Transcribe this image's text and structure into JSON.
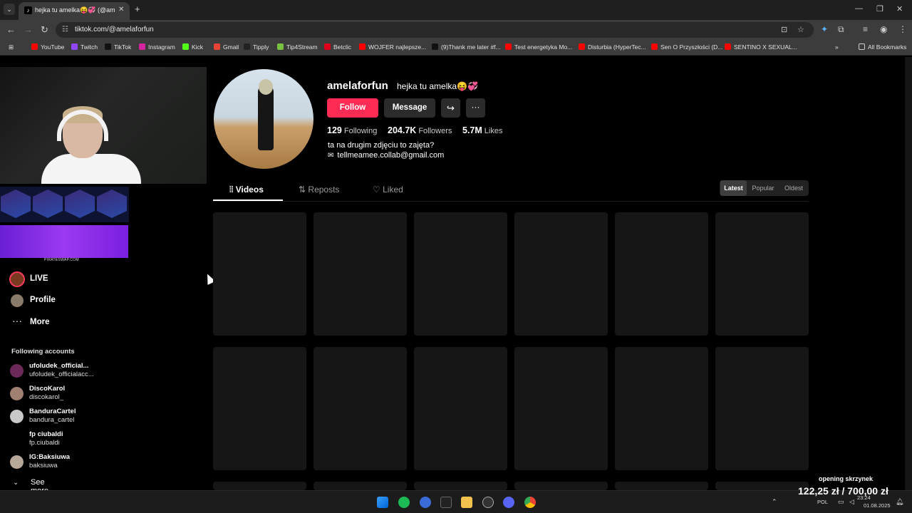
{
  "browser": {
    "tab_title": "hejka tu amelka😝💞 (@amelaforfun)",
    "url": "tiktok.com/@amelaforfun",
    "bookmarks": [
      {
        "label": "YouTube",
        "color": "#ff0000"
      },
      {
        "label": "Twitch",
        "color": "#9146ff"
      },
      {
        "label": "TikTok",
        "color": "#111111"
      },
      {
        "label": "Instagram",
        "color": "#d6249f"
      },
      {
        "label": "Kick",
        "color": "#53fc18"
      },
      {
        "label": "Gmail",
        "color": "#ea4335"
      },
      {
        "label": "Tipply",
        "color": "#222222"
      },
      {
        "label": "Tip4Stream",
        "color": "#7ac142"
      },
      {
        "label": "Betclic",
        "color": "#e1001a"
      },
      {
        "label": "WOJFER najlepsze...",
        "color": "#ff0000"
      },
      {
        "label": "(9)Thank me later #f...",
        "color": "#111111"
      },
      {
        "label": "Test energetyka Mo...",
        "color": "#ff0000"
      },
      {
        "label": "Disturbia (HyperTec...",
        "color": "#ff0000"
      },
      {
        "label": "Sen O Przyszłości (D...",
        "color": "#ff0000"
      },
      {
        "label": "SENTINO X SEXUAL...",
        "color": "#ff0000"
      }
    ],
    "all_bookmarks_label": "All Bookmarks"
  },
  "promo": {
    "site_text": "PIRATESWAP.COM"
  },
  "sidebar": {
    "items": [
      {
        "label": "LIVE",
        "icon": "live-avatar-icon"
      },
      {
        "label": "Profile",
        "icon": "profile-avatar-icon"
      },
      {
        "label": "More",
        "icon": "more-dots-icon"
      }
    ],
    "following_title": "Following accounts",
    "accounts": [
      {
        "name": "ufoludek_official...",
        "handle": "ufoludek_officialacc..."
      },
      {
        "name": "DiscoKarol",
        "handle": "discokarol_"
      },
      {
        "name": "BanduraCartel",
        "handle": "bandura_cartel"
      },
      {
        "name": "fp ciubaldi",
        "handle": "fp.ciubaldi"
      },
      {
        "name": "IG:Baksiuwa",
        "handle": "baksiuwa"
      }
    ],
    "see_more": "See more"
  },
  "profile": {
    "username": "amelaforfun",
    "nickname": "hejka tu amelka😝💞",
    "follow": "Follow",
    "message": "Message",
    "stats": [
      {
        "value": "129",
        "label": "Following"
      },
      {
        "value": "204.7K",
        "label": "Followers"
      },
      {
        "value": "5.7M",
        "label": "Likes"
      }
    ],
    "bio_line1": "ta na drugim zdjęciu to zajęta?",
    "bio_line2": "tellmeamee.collab@gmail.com",
    "accent_color": "#fe2c55"
  },
  "tabs": [
    {
      "label": "Videos",
      "icon": "grid-icon",
      "active": true
    },
    {
      "label": "Reposts",
      "icon": "repost-icon",
      "active": false
    },
    {
      "label": "Liked",
      "icon": "heart-icon",
      "active": false
    }
  ],
  "sort": [
    {
      "label": "Latest",
      "active": true
    },
    {
      "label": "Popular",
      "active": false
    },
    {
      "label": "Oldest",
      "active": false
    }
  ],
  "overlay": {
    "title": "opening skrzynek",
    "amount": "122,25 zł / 700,00 zł"
  },
  "taskbar": {
    "lang": "POL",
    "time": "23:24",
    "date": "01.08.2025"
  }
}
